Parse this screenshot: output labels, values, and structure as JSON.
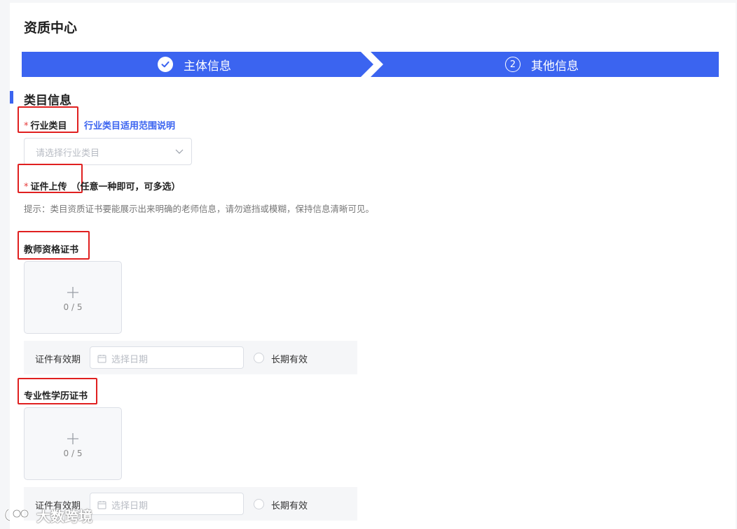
{
  "page": {
    "title": "资质中心"
  },
  "stepper": {
    "color": "#3b64f0",
    "steps": [
      {
        "label": "主体信息",
        "state": "done",
        "icon": "check-icon"
      },
      {
        "label": "其他信息",
        "state": "current",
        "number": "2"
      }
    ]
  },
  "section": {
    "title": "类目信息"
  },
  "industry": {
    "label": "行业类目",
    "required_mark": "*",
    "link": "行业类目适用范围说明",
    "placeholder": "请选择行业类目"
  },
  "cert_upload": {
    "label": "证件上传",
    "required_mark": "*",
    "note": "（任意一种即可，可多选）",
    "hint": "提示：类目资质证书要能展示出来明确的老师信息，请勿遮挡或模糊，保持信息清晰可见。"
  },
  "certificates": [
    {
      "title": "教师资格证书",
      "count": "0 / 5",
      "validity_label": "证件有效期",
      "date_placeholder": "选择日期",
      "long_term_label": "长期有效"
    },
    {
      "title": "专业性学历证书",
      "count": "0 / 5",
      "validity_label": "证件有效期",
      "date_placeholder": "选择日期",
      "long_term_label": "长期有效"
    }
  ],
  "watermark": {
    "text": "大数跨境"
  }
}
